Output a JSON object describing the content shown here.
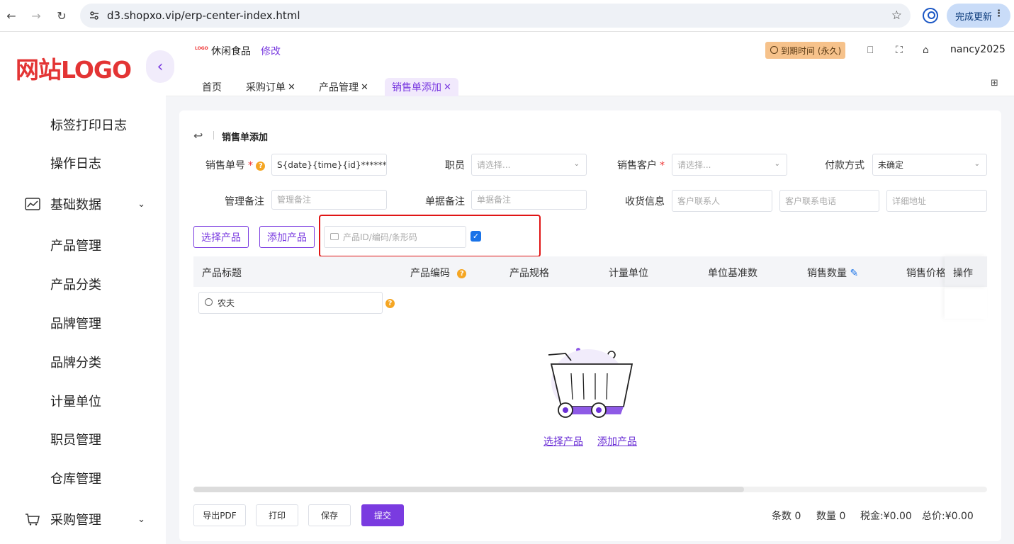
{
  "browser": {
    "url": "d3.shopxo.vip/erp-center-index.html",
    "update_label": "完成更新"
  },
  "sidebar": {
    "logo": "网站LOGO",
    "items": [
      {
        "label": "标签打印日志",
        "type": "sub"
      },
      {
        "label": "操作日志",
        "type": "sub"
      },
      {
        "label": "基础数据",
        "type": "group"
      },
      {
        "label": "产品管理",
        "type": "sub"
      },
      {
        "label": "产品分类",
        "type": "sub"
      },
      {
        "label": "品牌管理",
        "type": "sub"
      },
      {
        "label": "品牌分类",
        "type": "sub"
      },
      {
        "label": "计量单位",
        "type": "sub"
      },
      {
        "label": "职员管理",
        "type": "sub"
      },
      {
        "label": "仓库管理",
        "type": "sub"
      },
      {
        "label": "采购管理",
        "type": "group"
      }
    ]
  },
  "header": {
    "logo_text": "LOGO",
    "shop_name": "休闲食品",
    "edit_label": "修改",
    "expiry": "到期时间 (永久)",
    "user": "nancy2025"
  },
  "tabs": [
    {
      "label": "首页",
      "closable": false
    },
    {
      "label": "采购订单",
      "closable": true
    },
    {
      "label": "产品管理",
      "closable": true
    },
    {
      "label": "销售单添加",
      "closable": true,
      "active": true
    }
  ],
  "form": {
    "page_title": "销售单添加",
    "order_no_label": "销售单号",
    "order_no_value": "S{date}{time}{id}******",
    "staff_label": "职员",
    "staff_placeholder": "请选择...",
    "customer_label": "销售客户",
    "customer_placeholder": "请选择...",
    "payment_label": "付款方式",
    "payment_value": "未确定",
    "admin_note_label": "管理备注",
    "admin_note_placeholder": "管理备注",
    "doc_note_label": "单据备注",
    "doc_note_placeholder": "单据备注",
    "shipping_label": "收货信息",
    "contact_placeholder": "客户联系人",
    "phone_placeholder": "客户联系电话",
    "address_placeholder": "详细地址"
  },
  "toolbar": {
    "select_product": "选择产品",
    "add_product": "添加产品",
    "scan_placeholder": "产品ID/编码/条形码",
    "scan_checked": true
  },
  "table": {
    "columns": [
      "产品标题",
      "产品编码",
      "产品规格",
      "计量单位",
      "单位基准数",
      "销售数量",
      "销售价格",
      "操作"
    ],
    "filter_value": "农夫",
    "empty_links": [
      "选择产品",
      "添加产品"
    ]
  },
  "footer": {
    "export_pdf": "导出PDF",
    "print": "打印",
    "save": "保存",
    "submit": "提交",
    "count_label": "条数",
    "count_value": "0",
    "qty_label": "数量",
    "qty_value": "0",
    "tax_label": "税金:",
    "tax_value": "¥0.00",
    "total_label": "总价:",
    "total_value": "¥0.00"
  },
  "colors": {
    "accent": "#7a3be0",
    "logo_red": "#e33434",
    "expiry_bg": "#f6c28b",
    "highlight_box": "#e01515"
  }
}
